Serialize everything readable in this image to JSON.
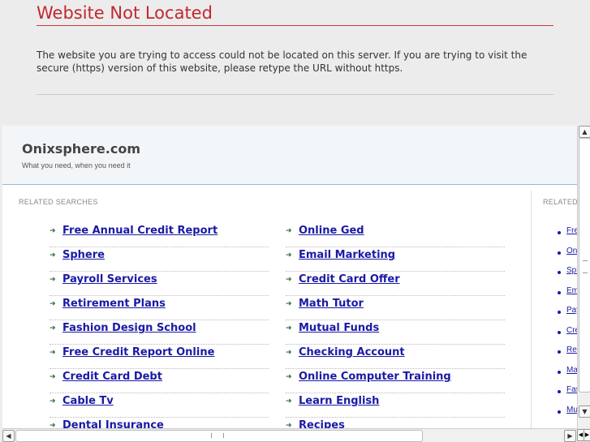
{
  "error": {
    "title": "Website Not Located",
    "message": "The website you are trying to access could not be located on this server. If you are trying to visit the secure (https) version of this website, please retype the URL without https.",
    "accent_color": "#c2282e"
  },
  "frame": {
    "site_name": "Onixsphere.com",
    "tagline": "What you need, when you need it",
    "related_title": "RELATED SEARCHES",
    "left_links": [
      "Free Annual Credit Report",
      "Sphere",
      "Payroll Services",
      "Retirement Plans",
      "Fashion Design School",
      "Free Credit Report Online",
      "Credit Card Debt",
      "Cable Tv",
      "Dental Insurance"
    ],
    "right_links": [
      "Online Ged",
      "Email Marketing",
      "Credit Card Offer",
      "Math Tutor",
      "Mutual Funds",
      "Checking Account",
      "Online Computer Training",
      "Learn English",
      "Recipes"
    ],
    "side_title": "RELATED",
    "side_links": [
      "Fre",
      "Onl",
      "Sph",
      "Em",
      "Pay",
      "Cre",
      "Ret",
      "Ma",
      "Fas",
      "Mu"
    ],
    "link_color": "#1a1aa6",
    "arrow_icon": "arrow-right-icon"
  }
}
